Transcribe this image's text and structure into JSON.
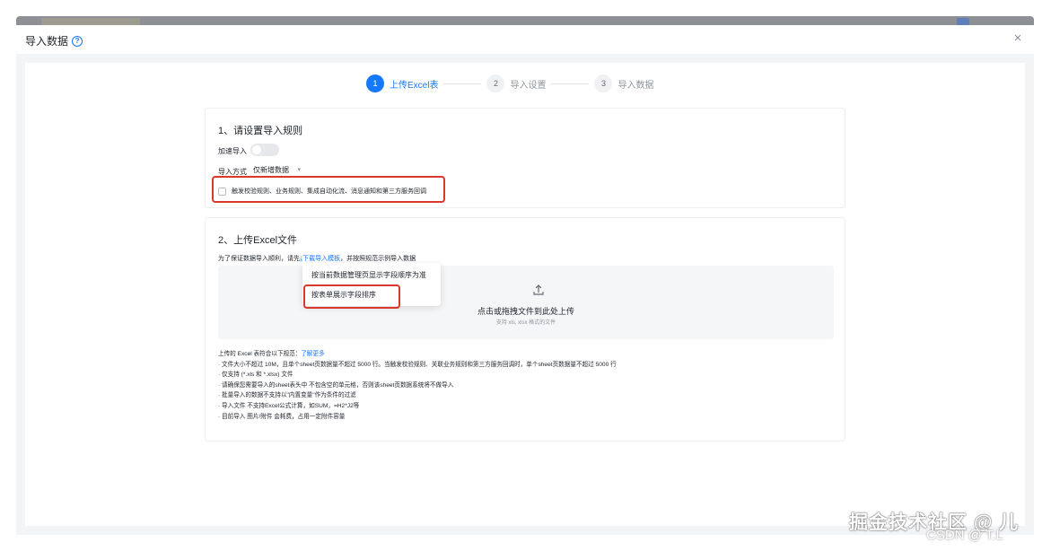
{
  "colors": {
    "primary": "#1677ff",
    "highlight": "#d9382a"
  },
  "modal": {
    "title": "导入数据",
    "help_icon": "?",
    "close_icon": "×"
  },
  "steps": [
    {
      "num": "1",
      "label": "上传Excel表",
      "active": true
    },
    {
      "num": "2",
      "label": "导入设置"
    },
    {
      "num": "3",
      "label": "导入数据"
    }
  ],
  "rules_card": {
    "title": "1、请设置导入规则",
    "fast_import_label": "加速导入",
    "fast_import_enabled": false,
    "mode_label": "导入方式",
    "mode_value": "仅新增数据",
    "trigger_label": "触发校验规则、业务规则、集成自动化流、消息通知和第三方服务回调",
    "trigger_checked": false
  },
  "upload_card": {
    "title": "2、上传Excel文件",
    "instruction_prefix": "为了保证数据导入顺利，请先",
    "instruction_link": "下载导入模板",
    "instruction_suffix": "，并按照规范示例导入数据",
    "drop_text": "点击或拖拽文件到此处上传",
    "drop_sub": "支持 xls, xlsx 格式的文件",
    "dropdown_items": [
      "按当前数据管理页显示字段顺序为准",
      "按表单展示字段排序"
    ]
  },
  "rules": {
    "intro": "上传的 Excel 表符合以下规范：",
    "intro_link": "了解更多",
    "lines": [
      "· 文件大小不超过 10M，且单个sheet页数据量不超过 5000 行。当触发校验规则、关联业务规则和第三方服务回调时，单个sheet页数据量不超过 5000 行",
      "· 仅支持 (*.xls 和 *.xlsx) 文件",
      "· 请确保您需要导入的sheet表头中 不包含空的单元格，否则该sheet页数据系统将不做导入",
      "· 批量导入的数据不支持以\"内置变量\"作为条件的过滤",
      "· 导入文件 不支持Excel公式计算，如SUM，=H2*J2等",
      "· 目前导入 图片/附件 会耗费，占用一定附件容量"
    ]
  },
  "watermark": {
    "text": "掘金技术社区 @ 儿",
    "sub": "CSDN @ T.L"
  }
}
